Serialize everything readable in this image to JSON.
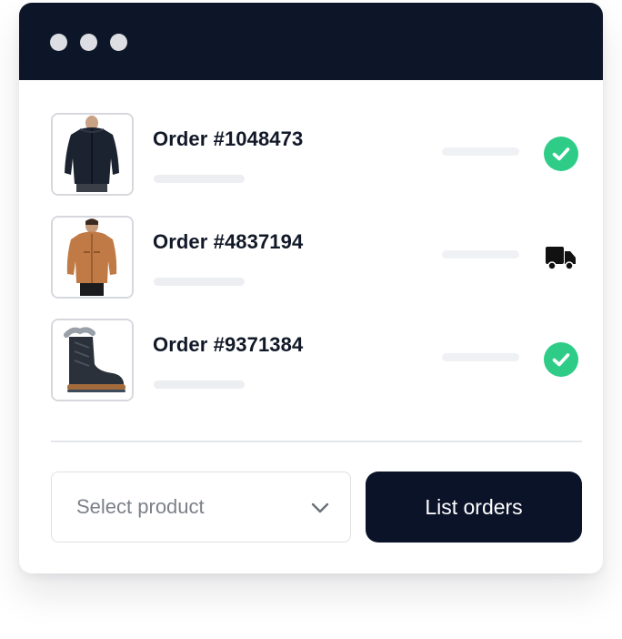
{
  "window": {
    "controls": [
      "window-dot",
      "window-dot",
      "window-dot"
    ]
  },
  "orders": [
    {
      "title": "Order #1048473",
      "product_icon": "black-jacket-image",
      "status_icon": "check-circle-icon",
      "status_color": "#2ecc87"
    },
    {
      "title": "Order #4837194",
      "product_icon": "tan-jacket-image",
      "status_icon": "truck-icon",
      "status_color": "#111111"
    },
    {
      "title": "Order #9371384",
      "product_icon": "winter-boot-image",
      "status_icon": "check-circle-icon",
      "status_color": "#2ecc87"
    }
  ],
  "select": {
    "placeholder": "Select product",
    "icon": "chevron-down-icon"
  },
  "button": {
    "label": "List orders",
    "color": "#0b1329"
  },
  "colors": {
    "titlebar": "#0d1628",
    "success": "#2ecc87"
  }
}
